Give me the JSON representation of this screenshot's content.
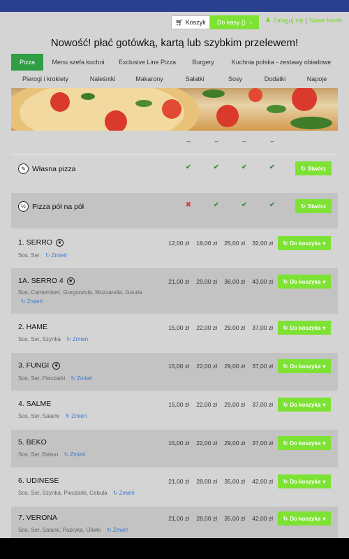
{
  "header": {
    "cart_label": "Koszyk",
    "checkout_label": "Do kasy ()",
    "login_label": "Zaloguj się",
    "register_label": "Nowe konto",
    "separator": "|"
  },
  "headline": "Nowość! płać gotówką, kartą lub szybkim przelewem!",
  "categories_row1": [
    "Pizza",
    "Menu szefa kuchni",
    "Exclusive Line Pizza",
    "Burgery",
    "Kuchnia polska - zestawy obiadowe"
  ],
  "categories_row2": [
    "Pierogi i krokiety",
    "Naleśniki",
    "Makarony",
    "Sałatki",
    "Sosy",
    "Dodatki",
    "Napoje"
  ],
  "size_labels": [
    "–",
    "–",
    "–",
    "–"
  ],
  "custom": [
    {
      "name": "Własna pizza",
      "button": "Stwórz",
      "availability": [
        true,
        true,
        true,
        true
      ]
    },
    {
      "name": "Pizza pół na pół",
      "button": "Stwórz",
      "availability": [
        false,
        true,
        true,
        true
      ]
    }
  ],
  "products": [
    {
      "name": "1. SERRO",
      "ingredients": "Sos, Ser",
      "change": "Zmień",
      "prices": [
        "12,00 zł",
        "18,00 zł",
        "25,00 zł",
        "32,00 zł"
      ],
      "button": "Do koszyka"
    },
    {
      "name": "1A. SERRO 4",
      "ingredients": "Sos, Camembert, Gorgonzola, Mozzarella, Gouda",
      "change": "Zmień",
      "prices": [
        "21,00 zł",
        "29,00 zł",
        "36,00 zł",
        "43,00 zł"
      ],
      "button": "Do koszyka"
    },
    {
      "name": "2. HAME",
      "ingredients": "Sos, Ser, Szynka",
      "change": "Zmień",
      "prices": [
        "15,00 zł",
        "22,00 zł",
        "29,00 zł",
        "37,00 zł"
      ],
      "button": "Do koszyka"
    },
    {
      "name": "3. FUNGI",
      "ingredients": "Sos, Ser, Pieczarki",
      "change": "Zmień",
      "prices": [
        "15,00 zł",
        "22,00 zł",
        "29,00 zł",
        "37,00 zł"
      ],
      "button": "Do koszyka"
    },
    {
      "name": "4. SALME",
      "ingredients": "Sos, Ser, Salami",
      "change": "Zmień",
      "prices": [
        "15,00 zł",
        "22,00 zł",
        "29,00 zł",
        "37,00 zł"
      ],
      "button": "Do koszyka"
    },
    {
      "name": "5. BEKO",
      "ingredients": "Sos, Ser, Bekon",
      "change": "Zmień",
      "prices": [
        "15,00 zł",
        "22,00 zł",
        "29,00 zł",
        "37,00 zł"
      ],
      "button": "Do koszyka"
    },
    {
      "name": "6. UDINESE",
      "ingredients": "Sos, Ser, Szynka, Pieczarki, Cebula",
      "change": "Zmień",
      "prices": [
        "21,00 zł",
        "28,00 zł",
        "35,00 zł",
        "42,00 zł"
      ],
      "button": "Do koszyka"
    },
    {
      "name": "7. VERONA",
      "ingredients": "Sos, Ser, Salami, Papryka, Oliwki",
      "change": "Zmień",
      "prices": [
        "21,00 zł",
        "28,00 zł",
        "35,00 zł",
        "42,00 zł"
      ],
      "button": "Do koszyka"
    }
  ],
  "colors": {
    "top_bar": "#2b3f8f",
    "accent_green": "#7ee234",
    "active_tab": "#2f9e45",
    "link_blue": "#3b78c9"
  }
}
